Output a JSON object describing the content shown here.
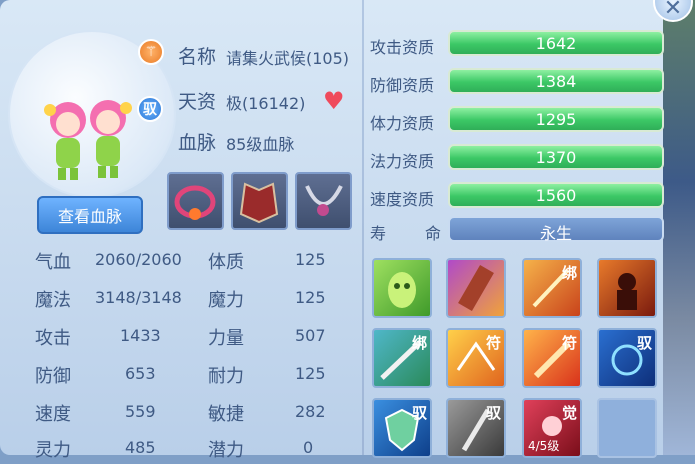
{
  "pet": {
    "name_label": "名称",
    "name_value": "请集火武侯(105)",
    "aptitude_label": "天资",
    "aptitude_value": "极(16142)",
    "bloodline_label": "血脉",
    "bloodline_value": "85级血脉",
    "badge_top": "⚚",
    "badge_ride": "驭"
  },
  "view_bloodline_button": "查看血脉",
  "stats": [
    {
      "label": "气血",
      "value": "2060/2060",
      "label2": "体质",
      "value2": "125"
    },
    {
      "label": "魔法",
      "value": "3148/3148",
      "label2": "魔力",
      "value2": "125"
    },
    {
      "label": "攻击",
      "value": "1433",
      "label2": "力量",
      "value2": "507"
    },
    {
      "label": "防御",
      "value": "653",
      "label2": "耐力",
      "value2": "125"
    },
    {
      "label": "速度",
      "value": "559",
      "label2": "敏捷",
      "value2": "282"
    },
    {
      "label": "灵力",
      "value": "485",
      "label2": "潜力",
      "value2": "0"
    }
  ],
  "aptitudes": [
    {
      "label": "攻击资质",
      "value": "1642"
    },
    {
      "label": "防御资质",
      "value": "1384"
    },
    {
      "label": "体力资质",
      "value": "1295"
    },
    {
      "label": "法力资质",
      "value": "1370"
    },
    {
      "label": "速度资质",
      "value": "1560"
    }
  ],
  "life": {
    "label1": "寿",
    "label2": "命",
    "value": "永生"
  },
  "skills": [
    {
      "tag": ""
    },
    {
      "tag": ""
    },
    {
      "tag": "绑"
    },
    {
      "tag": ""
    },
    {
      "tag": "绑"
    },
    {
      "tag": "符"
    },
    {
      "tag": "符"
    },
    {
      "tag": "驭"
    },
    {
      "tag": "驭"
    },
    {
      "tag": "驭"
    },
    {
      "tag": "觉"
    },
    {
      "tag": ""
    }
  ],
  "skill_level_text": "4/5级",
  "colors": {
    "accent_green": "#3cc866",
    "text_blue": "#3f5a84",
    "button_blue": "#3d85d8"
  }
}
